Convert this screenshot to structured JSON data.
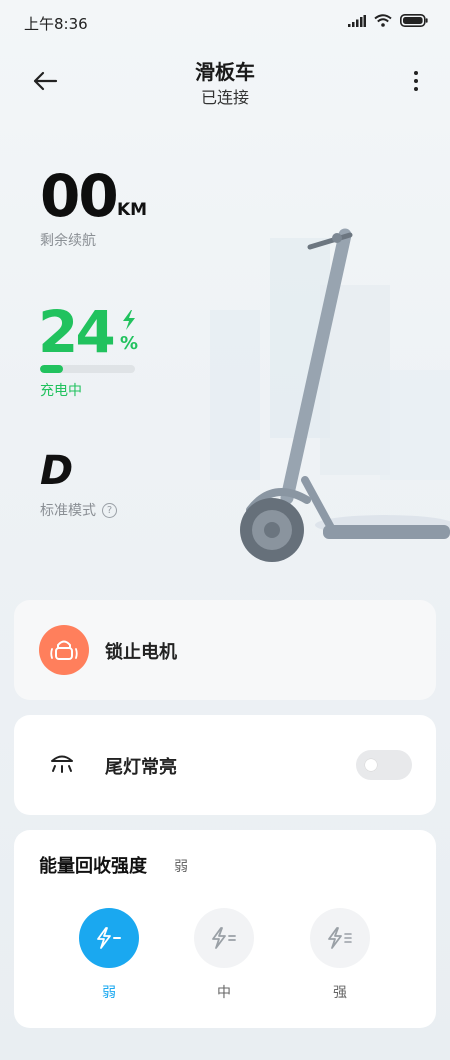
{
  "status_bar": {
    "time": "上午8:36"
  },
  "header": {
    "title": "滑板车",
    "subtitle": "已连接"
  },
  "range": {
    "value": "00",
    "unit": "KM",
    "label": "剩余续航"
  },
  "battery": {
    "value": "24",
    "percent_sign": "%",
    "level_percent": 24,
    "label": "充电中",
    "color": "#21c25e"
  },
  "mode": {
    "value": "D",
    "label": "标准模式"
  },
  "lock_card": {
    "label": "锁止电机",
    "accent": "#ff7f5c"
  },
  "light_card": {
    "label": "尾灯常亮",
    "toggle_on": false
  },
  "regen_card": {
    "title": "能量回收强度",
    "current": "弱",
    "accent": "#1aa8f0",
    "options": [
      {
        "label": "弱",
        "active": true
      },
      {
        "label": "中",
        "active": false
      },
      {
        "label": "强",
        "active": false
      }
    ]
  }
}
